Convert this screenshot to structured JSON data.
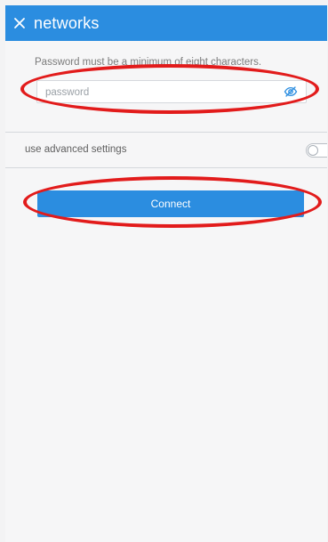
{
  "header": {
    "close_icon": "close-icon",
    "title": "networks",
    "background_color": "#2b8de0"
  },
  "form": {
    "hint": "Password must be a minimum of eight characters.",
    "password": {
      "value": "",
      "placeholder": "password",
      "toggle_visibility_icon": "eye-icon",
      "icon_color": "#2b8de0"
    },
    "advanced_settings": {
      "label": "use advanced settings",
      "enabled": false
    },
    "connect_button_label": "Connect"
  },
  "theme": {
    "accent": "#2b8de0",
    "annotation": "#e21b1b"
  }
}
